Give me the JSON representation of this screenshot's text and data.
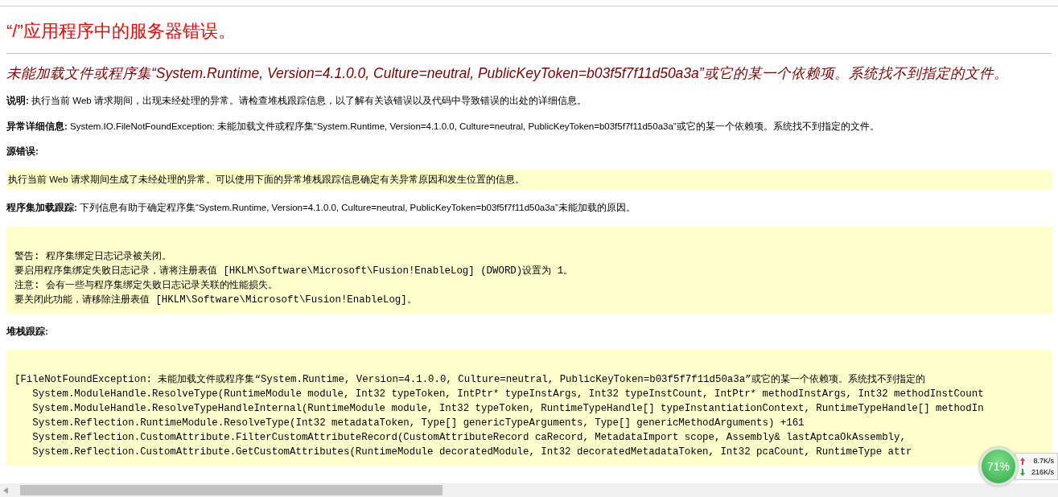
{
  "title": "“/”应用程序中的服务器错误。",
  "error_message": "未能加载文件或程序集“System.Runtime, Version=4.1.0.0, Culture=neutral, PublicKeyToken=b03f5f7f11d50a3a”或它的某一个依赖项。系统找不到指定的文件。",
  "sections": [
    {
      "kind": "text",
      "label": "说明:",
      "text": "执行当前 Web 请求期间，出现未经处理的异常。请检查堆栈跟踪信息，以了解有关该错误以及代码中导致错误的出处的详细信息。"
    },
    {
      "kind": "text",
      "label": "异常详细信息:",
      "text": "System.IO.FileNotFoundException: 未能加载文件或程序集“System.Runtime, Version=4.1.0.0, Culture=neutral, PublicKeyToken=b03f5f7f11d50a3a”或它的某一个依赖项。系统找不到指定的文件。"
    },
    {
      "kind": "heading",
      "label": "源错误:"
    },
    {
      "kind": "code",
      "lines": [
        "执行当前 Web 请求期间生成了未经处理的异常。可以使用下面的异常堆栈跟踪信息确定有关异常原因和发生位置的信息。"
      ]
    },
    {
      "kind": "text",
      "label": "程序集加载跟踪:",
      "text": "下列信息有助于确定程序集“System.Runtime, Version=4.1.0.0, Culture=neutral, PublicKeyToken=b03f5f7f11d50a3a”未能加载的原因。"
    },
    {
      "kind": "pre",
      "lines": [
        "警告: 程序集绑定日志记录被关闭。",
        "要启用程序集绑定失败日志记录，请将注册表值 [HKLM\\Software\\Microsoft\\Fusion!EnableLog] (DWORD)设置为 1。",
        "注意: 会有一些与程序集绑定失败日志记录关联的性能损失。",
        "要关闭此功能，请移除注册表值 [HKLM\\Software\\Microsoft\\Fusion!EnableLog]。"
      ]
    },
    {
      "kind": "heading",
      "label": "堆栈跟踪:"
    },
    {
      "kind": "pre",
      "lines": [
        "[FileNotFoundException: 未能加载文件或程序集“System.Runtime, Version=4.1.0.0, Culture=neutral, PublicKeyToken=b03f5f7f11d50a3a”或它的某一个依赖项。系统找不到指定的",
        "   System.ModuleHandle.ResolveType(RuntimeModule module, Int32 typeToken, IntPtr* typeInstArgs, Int32 typeInstCount, IntPtr* methodInstArgs, Int32 methodInstCount",
        "   System.ModuleHandle.ResolveTypeHandleInternal(RuntimeModule module, Int32 typeToken, RuntimeTypeHandle[] typeInstantiationContext, RuntimeTypeHandle[] methodIn",
        "   System.Reflection.RuntimeModule.ResolveType(Int32 metadataToken, Type[] genericTypeArguments, Type[] genericMethodArguments) +161",
        "   System.Reflection.CustomAttribute.FilterCustomAttributeRecord(CustomAttributeRecord caRecord, MetadataImport scope, Assembly& lastAptcaOkAssembly,",
        "   System.Reflection.CustomAttribute.GetCustomAttributes(RuntimeModule decoratedModule, Int32 decoratedMetadataToken, Int32 pcaCount, RuntimeType attr"
      ]
    }
  ],
  "net_monitor": {
    "percent": "71%",
    "upload": "8.7K/s",
    "download": "216K/s"
  }
}
